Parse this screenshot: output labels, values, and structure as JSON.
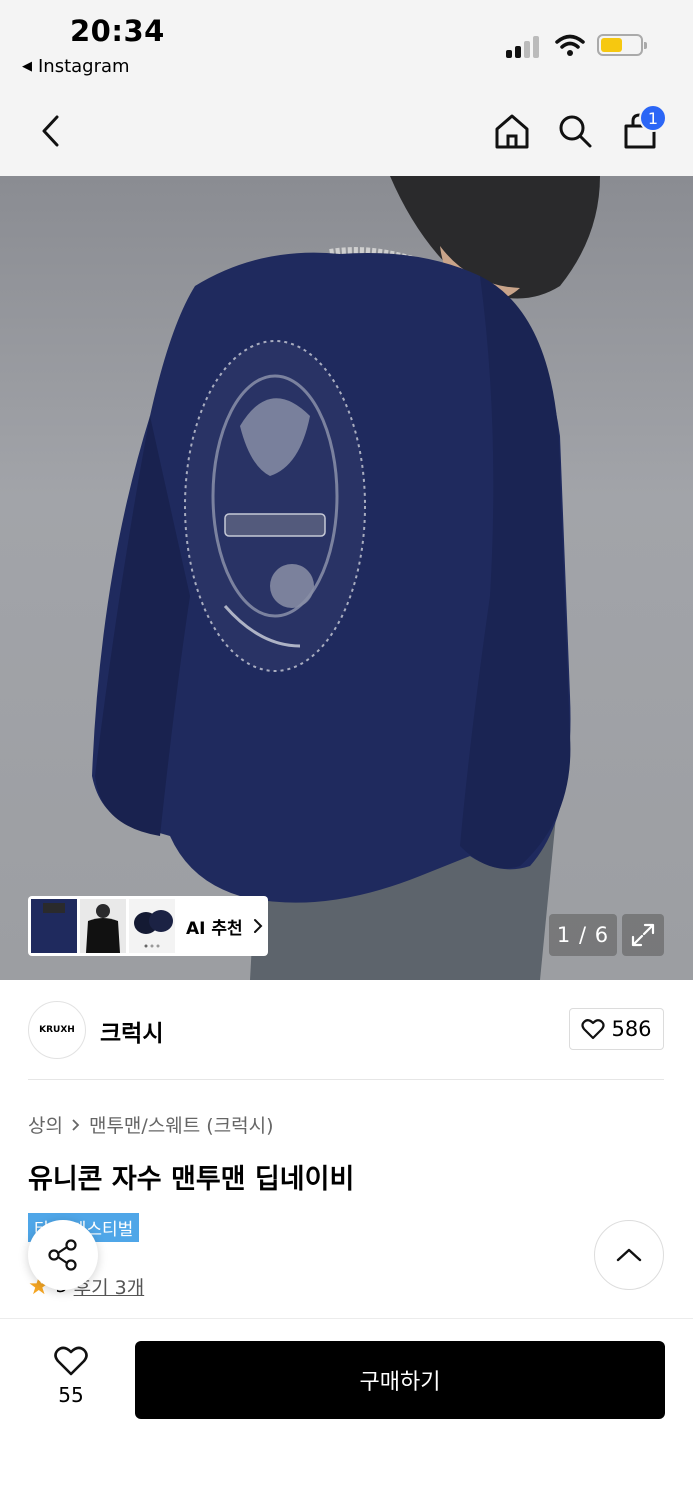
{
  "status_bar": {
    "time": "20:34",
    "back_app": "Instagram",
    "signal_icon": "cellular-signal-icon",
    "wifi_icon": "wifi-icon",
    "battery_icon": "battery-icon",
    "battery_color": "#f6c810"
  },
  "nav": {
    "back_icon": "chevron-left-icon",
    "home_icon": "home-icon",
    "search_icon": "search-icon",
    "cart_icon": "shopping-bag-icon",
    "cart_count": "1",
    "badge_color": "#2b66f6"
  },
  "gallery": {
    "ai_label": "AI 추천",
    "counter": "1 / 6",
    "expand_icon": "expand-icon"
  },
  "brand": {
    "logo_text": "KRUXH",
    "name": "크럭시",
    "like_count": "586"
  },
  "product": {
    "breadcrumb": [
      "상의",
      "맨투맨/스웨트 (크럭시)"
    ],
    "title": "유니콘 자수 맨투맨 딥네이비",
    "badge": "타임 페스티벌",
    "badge_color": "#4fa6e8",
    "rating": "5",
    "review_link": "후기 3개"
  },
  "bottom": {
    "wish_count": "55",
    "buy_label": "구매하기"
  }
}
